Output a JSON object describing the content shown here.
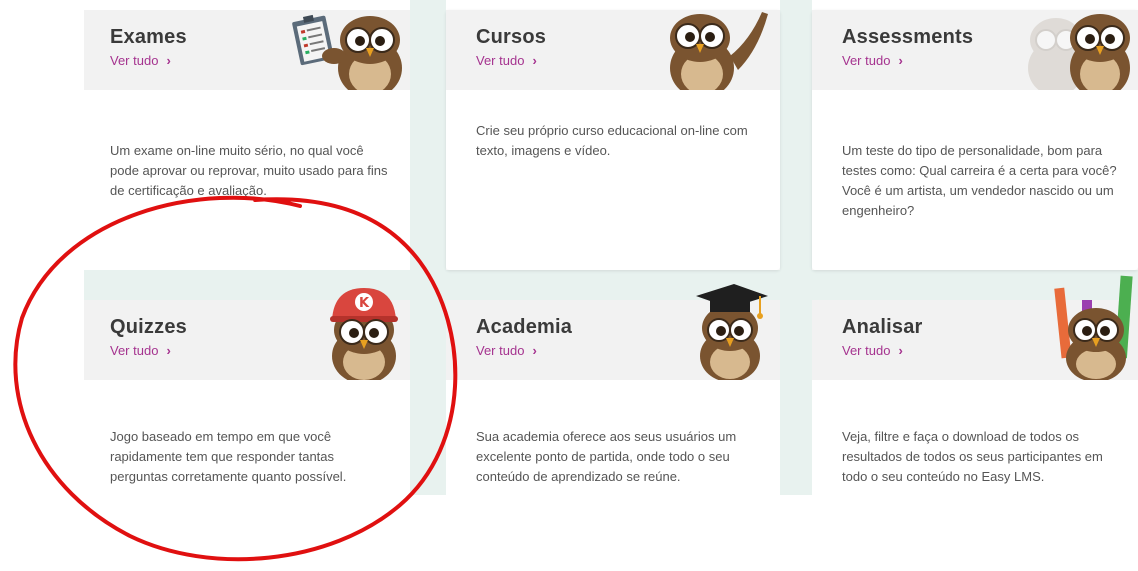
{
  "colors": {
    "accent": "#a5338f",
    "title": "#3a3a3a",
    "text": "#555555",
    "header_bg": "#f2f2f2",
    "band_bg": "#e8f2ef",
    "annotation": "#e01010"
  },
  "cards": [
    {
      "title": "Exames",
      "link": "Ver tudo",
      "description": "Um exame on-line muito sério, no qual você pode aprovar ou reprovar, muito usado para fins de certificação e avaliação.",
      "icon": "owl-with-clipboard-icon"
    },
    {
      "title": "Cursos",
      "link": "Ver tudo",
      "description": "Crie seu próprio curso educacional on-line com texto, imagens e vídeo.",
      "icon": "owl-waving-icon"
    },
    {
      "title": "Assessments",
      "link": "Ver tudo",
      "description": "Um teste do tipo de personalidade, bom para testes como: Qual carreira é a certa para você? Você é um artista, um vendedor nascido ou um engenheiro?",
      "icon": "owl-with-reflection-icon"
    },
    {
      "title": "Quizzes",
      "link": "Ver tudo",
      "description": "Jogo baseado em tempo em que você rapidamente tem que responder tantas perguntas corretamente quanto possível.",
      "icon": "owl-with-red-cap-icon"
    },
    {
      "title": "Academia",
      "link": "Ver tudo",
      "description": "Sua academia oferece aos seus usuários um excelente ponto de partida, onde todo o seu conteúdo de aprendizado se reúne.",
      "icon": "owl-with-graduation-cap-icon"
    },
    {
      "title": "Analisar",
      "link": "Ver tudo",
      "description": "Veja, filtre e faça o download de todos os resultados de todos os seus participantes em todo o seu conteúdo no Easy LMS.",
      "icon": "owl-with-bar-chart-icon"
    }
  ],
  "cap_letter": "K",
  "annotation": "red-circle-highlight"
}
